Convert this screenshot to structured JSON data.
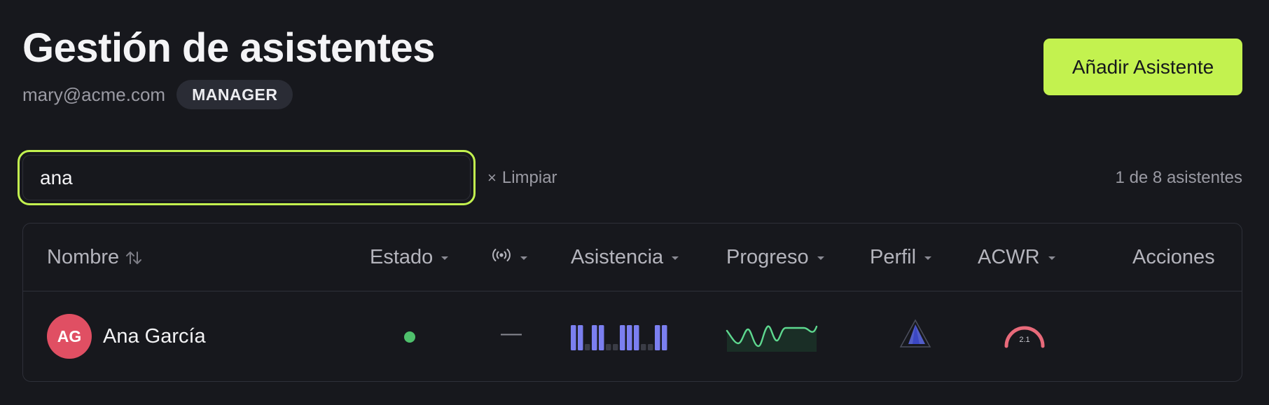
{
  "header": {
    "title": "Gestión de asistentes",
    "email": "mary@acme.com",
    "role_badge": "MANAGER",
    "add_button_label": "Añadir Asistente"
  },
  "search": {
    "value": "ana",
    "clear_label": "Limpiar",
    "result_count": "1 de 8 asistentes"
  },
  "table": {
    "columns": {
      "nombre": "Nombre",
      "estado": "Estado",
      "asistencia": "Asistencia",
      "progreso": "Progreso",
      "perfil": "Perfil",
      "acwr": "ACWR",
      "acciones": "Acciones"
    },
    "rows": [
      {
        "initials": "AG",
        "name": "Ana García",
        "status": "active",
        "status_color": "#4fc06c",
        "signal": "—",
        "attendance": [
          1,
          1,
          0,
          1,
          1,
          0,
          0,
          1,
          1,
          1,
          0,
          0,
          1,
          1
        ],
        "acwr_value": "2.1",
        "avatar_color": "#e04f63"
      }
    ]
  },
  "colors": {
    "accent": "#c3f24f",
    "background": "#17181d",
    "attendance_bar": "#7b7ff0",
    "progress_line": "#5ed88f",
    "acwr_gauge": "#e86a7a"
  }
}
